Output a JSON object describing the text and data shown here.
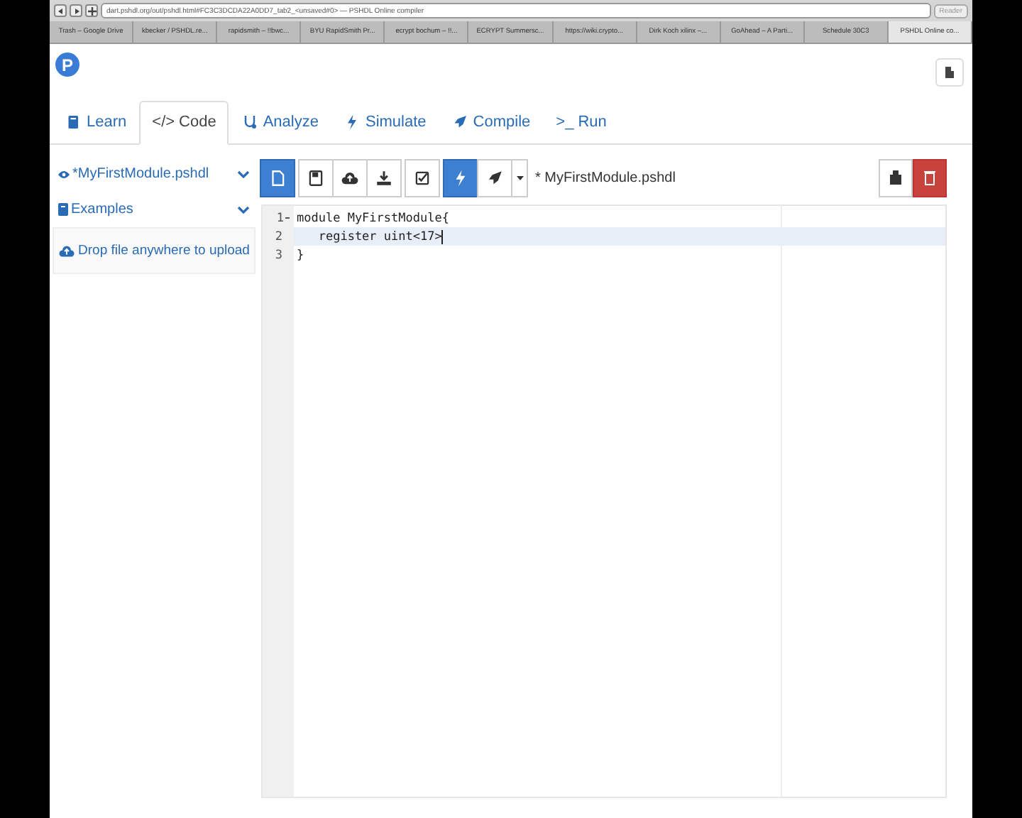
{
  "browser": {
    "url": "dart.pshdl.org/out/pshdl.html#FC3C3DCDA22A0DD7_tab2_<unsaved#0> — PSHDL Online compiler",
    "reader": "Reader",
    "tabs": [
      {
        "label": "Trash – Google Drive",
        "selected": false
      },
      {
        "label": "kbecker / PSHDL.re...",
        "selected": false
      },
      {
        "label": "rapidsmith – !!bwc...",
        "selected": false
      },
      {
        "label": "BYU RapidSmith Pr...",
        "selected": false
      },
      {
        "label": "ecrypt bochum – !!...",
        "selected": false
      },
      {
        "label": "ECRYPT Summersc...",
        "selected": false
      },
      {
        "label": "https://wiki.crypto...",
        "selected": false
      },
      {
        "label": "Dirk Koch xilinx –...",
        "selected": false
      },
      {
        "label": "GoAhead – A Parti...",
        "selected": false
      },
      {
        "label": "Schedule 30C3",
        "selected": false
      },
      {
        "label": "PSHDL Online co...",
        "selected": true
      }
    ]
  },
  "logo": "P",
  "tabs": [
    {
      "label": "Learn",
      "selected": false
    },
    {
      "label": "Code",
      "glyph": "</>",
      "selected": true
    },
    {
      "label": "Analyze",
      "selected": false
    },
    {
      "label": "Simulate",
      "selected": false
    },
    {
      "label": "Compile",
      "selected": false
    },
    {
      "label": "Run",
      "glyph": ">_",
      "selected": false
    }
  ],
  "sidebar": {
    "file": "*MyFirstModule.pshdl",
    "examples": "Examples",
    "upload": "Drop file anywhere to upload"
  },
  "toolbar": {
    "buttons": [
      {
        "on": true
      },
      {
        "on": false
      },
      {
        "on": false
      },
      {
        "on": false
      },
      {
        "on": false
      },
      {
        "on": true
      },
      {
        "on": false
      }
    ],
    "file_name": "* MyFirstModule.pshdl"
  },
  "editor": {
    "lines": [
      {
        "number": "1",
        "text": "module MyFirstModule{",
        "foldable": true,
        "current": false
      },
      {
        "number": "2",
        "text": "   register uint<17>",
        "foldable": false,
        "current": true
      },
      {
        "number": "3",
        "text": "}",
        "foldable": false,
        "current": false
      }
    ]
  }
}
